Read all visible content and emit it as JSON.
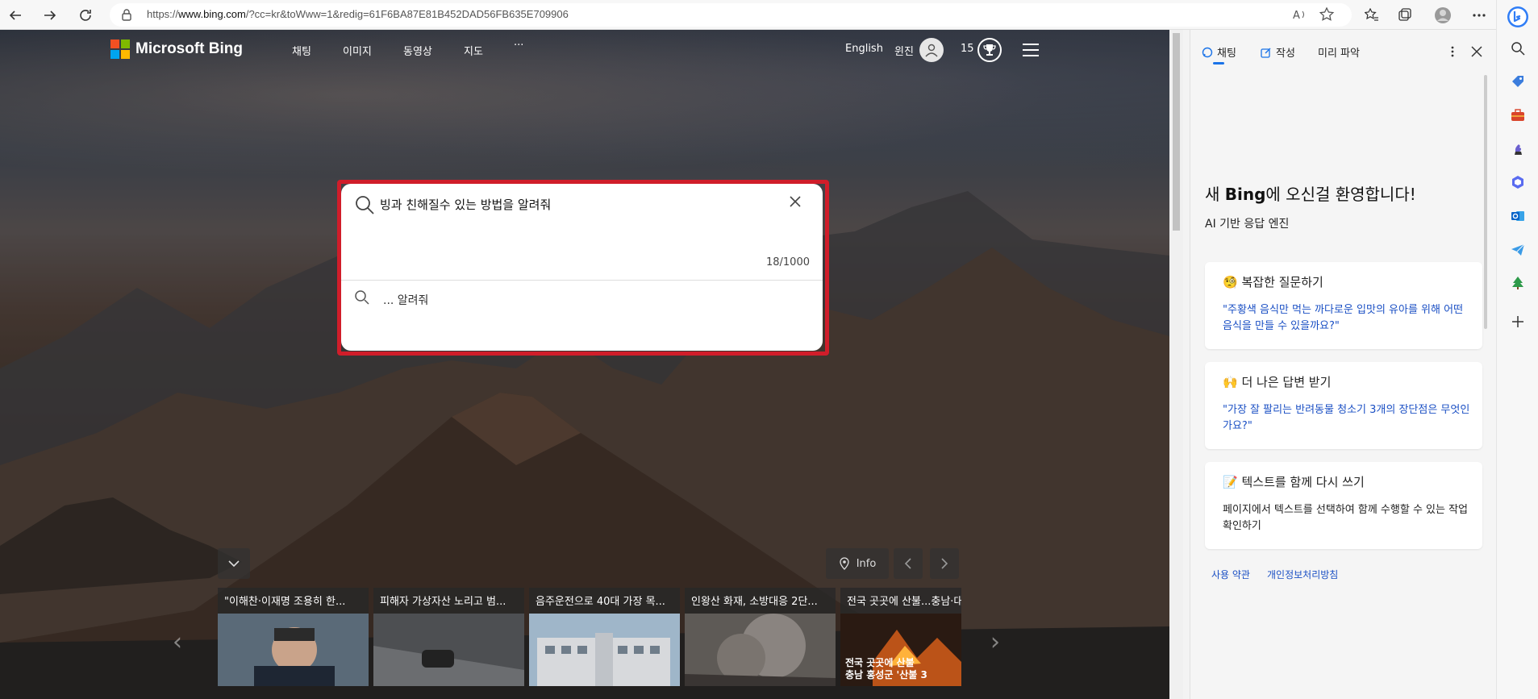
{
  "browser": {
    "url_prefix": "https://",
    "url_host": "www.bing.com",
    "url_rest": "/?cc=kr&toWww=1&redig=61F6BA87E81B452DAD56FB635E709906"
  },
  "header": {
    "logo_text": "Microsoft Bing",
    "nav": [
      "채팅",
      "이미지",
      "동영상",
      "지도",
      "···"
    ],
    "language": "English",
    "user_name": "윈진",
    "points": "15"
  },
  "search": {
    "query": "빙과 친해질수 있는 방법을 알려줘",
    "char_count": "18/1000",
    "suggestion": "... 알려줘"
  },
  "news": {
    "info_label": "Info",
    "cards": [
      {
        "title": "\"이해찬·이재명 조용히 한..."
      },
      {
        "title": "피해자 가상자산 노리고 범..."
      },
      {
        "title": "음주운전으로 40대 가장 목..."
      },
      {
        "title": "인왕산 화재, 소방대응 2단..."
      },
      {
        "title": "전국 곳곳에 산불...충남·대"
      }
    ],
    "card5_overlay": "전국 곳곳에 산불\n충남 홍성군 '산불 3"
  },
  "sidebar": {
    "tabs": [
      "채팅",
      "작성",
      "미리 파악"
    ],
    "welcome_pre": "새 ",
    "welcome_bold": "Bing",
    "welcome_post": "에 오신걸 환영합니다!",
    "subtitle": "AI 기반 응답 엔진",
    "cards": [
      {
        "emoji": "🧐",
        "title": "복잡한 질문하기",
        "body": "\"주황색 음식만 먹는 까다로운 입맛의 유아를 위해 어떤 음식을 만들 수 있을까요?\""
      },
      {
        "emoji": "🙌",
        "title": "더 나은 답변 받기",
        "body": "\"가장 잘 팔리는 반려동물 청소기 3개의 장단점은 무엇인가요?\""
      },
      {
        "emoji": "📝",
        "title": "텍스트를 함께 다시 쓰기",
        "body": "페이지에서 텍스트를 선택하여 함께 수행할 수 있는 작업 확인하기"
      }
    ],
    "links": [
      "사용 약관",
      "개인정보처리방침"
    ]
  },
  "colors": {
    "search_highlight": "#d01d2a",
    "link_blue": "#1a4fc4",
    "tab_accent": "#1a73e8"
  }
}
